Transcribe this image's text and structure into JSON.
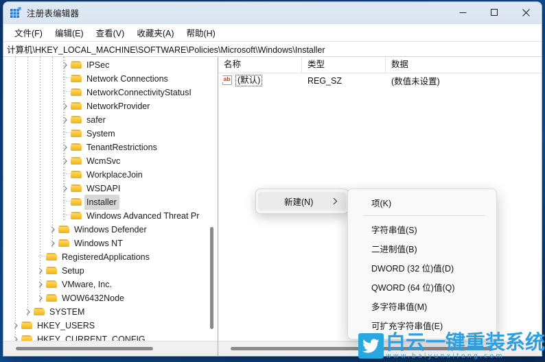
{
  "window": {
    "title": "注册表编辑器",
    "icon": "registry-editor-icon",
    "controls": {
      "minimize": "最小化",
      "maximize": "最大化",
      "close": "关闭"
    }
  },
  "menubar": {
    "items": [
      {
        "label": "文件(F)",
        "name": "menu-file"
      },
      {
        "label": "编辑(E)",
        "name": "menu-edit"
      },
      {
        "label": "查看(V)",
        "name": "menu-view"
      },
      {
        "label": "收藏夹(A)",
        "name": "menu-favorites"
      },
      {
        "label": "帮助(H)",
        "name": "menu-help"
      }
    ]
  },
  "address": {
    "path": "计算机\\HKEY_LOCAL_MACHINE\\SOFTWARE\\Policies\\Microsoft\\Windows\\Installer"
  },
  "tree": {
    "rows": [
      {
        "label": "IPSec",
        "indent": 5,
        "twisty": "collapsed",
        "selected": false
      },
      {
        "label": "Network Connections",
        "indent": 5,
        "twisty": "none",
        "selected": false
      },
      {
        "label": "NetworkConnectivityStatusI",
        "indent": 5,
        "twisty": "none",
        "selected": false
      },
      {
        "label": "NetworkProvider",
        "indent": 5,
        "twisty": "collapsed",
        "selected": false
      },
      {
        "label": "safer",
        "indent": 5,
        "twisty": "collapsed",
        "selected": false
      },
      {
        "label": "System",
        "indent": 5,
        "twisty": "none",
        "selected": false
      },
      {
        "label": "TenantRestrictions",
        "indent": 5,
        "twisty": "collapsed",
        "selected": false
      },
      {
        "label": "WcmSvc",
        "indent": 5,
        "twisty": "collapsed",
        "selected": false
      },
      {
        "label": "WorkplaceJoin",
        "indent": 5,
        "twisty": "none",
        "selected": false
      },
      {
        "label": "WSDAPI",
        "indent": 5,
        "twisty": "collapsed",
        "selected": false
      },
      {
        "label": "Installer",
        "indent": 5,
        "twisty": "none",
        "selected": true
      },
      {
        "label": "Windows Advanced Threat Pr",
        "indent": 5,
        "twisty": "none",
        "selected": false
      },
      {
        "label": "Windows Defender",
        "indent": 4,
        "twisty": "collapsed",
        "selected": false
      },
      {
        "label": "Windows NT",
        "indent": 4,
        "twisty": "collapsed",
        "selected": false
      },
      {
        "label": "RegisteredApplications",
        "indent": 3,
        "twisty": "none",
        "selected": false
      },
      {
        "label": "Setup",
        "indent": 3,
        "twisty": "collapsed",
        "selected": false
      },
      {
        "label": "VMware, Inc.",
        "indent": 3,
        "twisty": "collapsed",
        "selected": false
      },
      {
        "label": "WOW6432Node",
        "indent": 3,
        "twisty": "collapsed",
        "selected": false
      },
      {
        "label": "SYSTEM",
        "indent": 2,
        "twisty": "collapsed",
        "selected": false
      },
      {
        "label": "HKEY_USERS",
        "indent": 1,
        "twisty": "collapsed",
        "selected": false
      },
      {
        "label": "HKEY_CURRENT_CONFIG",
        "indent": 1,
        "twisty": "collapsed",
        "selected": false
      }
    ]
  },
  "values": {
    "columns": [
      {
        "label": "名称",
        "name": "column-name"
      },
      {
        "label": "类型",
        "name": "column-type"
      },
      {
        "label": "数据",
        "name": "column-data"
      }
    ],
    "rows": [
      {
        "name": "(默认)",
        "type": "REG_SZ",
        "data": "(数值未设置)",
        "icon": "string-value-icon"
      }
    ]
  },
  "context_menu": {
    "parent": {
      "label": "新建(N)",
      "arrow": "chevron-right-icon"
    },
    "submenu": {
      "first": "项(K)",
      "items": [
        "字符串值(S)",
        "二进制值(B)",
        "DWORD (32 位)值(D)",
        "QWORD (64 位)值(Q)",
        "多字符串值(M)",
        "可扩充字符串值(E)"
      ]
    }
  },
  "watermark": {
    "title": "白云一键重装系统",
    "url": "www.baiyunxitong.com",
    "badge": "bird-icon",
    "color": "#2f9fe0"
  },
  "colors": {
    "titlebar": "#dbe6f2",
    "folder": "#f7c333",
    "selection": "#d8d8d8",
    "desktop": "#0d4a91"
  }
}
